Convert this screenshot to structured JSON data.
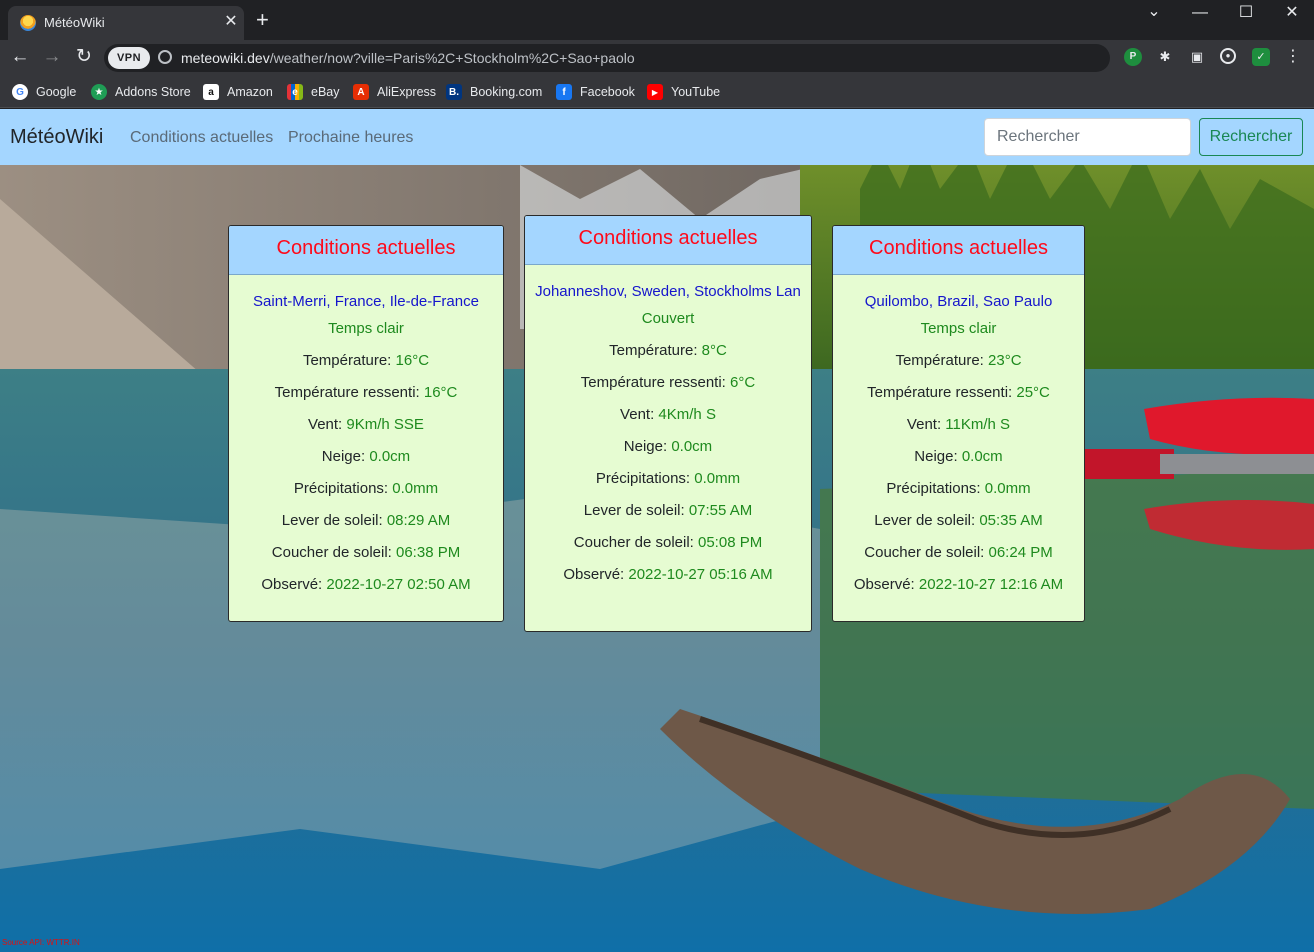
{
  "browser": {
    "tab_title": "MétéoWiki",
    "close_glyph": "✕",
    "new_tab_glyph": "+",
    "window_controls": {
      "minimize": "—",
      "maximize": "☐",
      "close": "✕",
      "tabs_menu": "⌄"
    },
    "nav": {
      "back": "←",
      "forward": "→",
      "reload": "↻"
    },
    "vpn_badge": "VPN",
    "url_host": "meteowiki.dev",
    "url_path": "/weather/now?ville=Paris%2C+Stockholm%2C+Sao+paolo",
    "extension_icons": [
      "P",
      "✱",
      "▣",
      "●",
      "✓",
      "⋮"
    ],
    "bookmarks": [
      {
        "label": "Google",
        "icon": "G",
        "color": "#ffffff"
      },
      {
        "label": "Addons Store",
        "icon": "★",
        "color": "#1f9d55"
      },
      {
        "label": "Amazon",
        "icon": "a",
        "color": "#ffffff"
      },
      {
        "label": "eBay",
        "icon": "e",
        "color": "#e53238"
      },
      {
        "label": "AliExpress",
        "icon": "A",
        "color": "#e62e04"
      },
      {
        "label": "Booking.com",
        "icon": "B.",
        "color": "#003580"
      },
      {
        "label": "Facebook",
        "icon": "f",
        "color": "#1877f2"
      },
      {
        "label": "YouTube",
        "icon": "▶",
        "color": "#ff0000"
      }
    ]
  },
  "navbar": {
    "brand": "MétéoWiki",
    "links": [
      "Conditions actuelles",
      "Prochaine heures"
    ],
    "search_placeholder": "Rechercher",
    "search_button": "Rechercher"
  },
  "labels": {
    "temperature": "Température: ",
    "feels_like": "Température ressenti: ",
    "wind": "Vent: ",
    "snow": "Neige: ",
    "precip": "Précipitations: ",
    "sunrise": "Lever de soleil: ",
    "sunset": "Coucher de soleil: ",
    "observed": "Observé: "
  },
  "cards": [
    {
      "header": "Conditions actuelles",
      "location": "Saint-Merri, France, Ile-de-France",
      "condition": "Temps clair",
      "temperature": "16°C",
      "feels_like": "16°C",
      "wind": "9Km/h SSE",
      "snow": "0.0cm",
      "precip": "0.0mm",
      "sunrise": "08:29 AM",
      "sunset": "06:38 PM",
      "observed": "2022-10-27 02:50 AM"
    },
    {
      "header": "Conditions actuelles",
      "location": "Johanneshov, Sweden, Stockholms Lan",
      "condition": "Couvert",
      "temperature": "8°C",
      "feels_like": "6°C",
      "wind": "4Km/h S",
      "snow": "0.0cm",
      "precip": "0.0mm",
      "sunrise": "07:55 AM",
      "sunset": "05:08 PM",
      "observed": "2022-10-27 05:16 AM"
    },
    {
      "header": "Conditions actuelles",
      "location": "Quilombo, Brazil, Sao Paulo",
      "condition": "Temps clair",
      "temperature": "23°C",
      "feels_like": "25°C",
      "wind": "11Km/h S",
      "snow": "0.0cm",
      "precip": "0.0mm",
      "sunrise": "05:35 AM",
      "sunset": "06:24 PM",
      "observed": "2022-10-27 12:16 AM"
    }
  ],
  "footer_credit": "Source API: WTTR.IN"
}
